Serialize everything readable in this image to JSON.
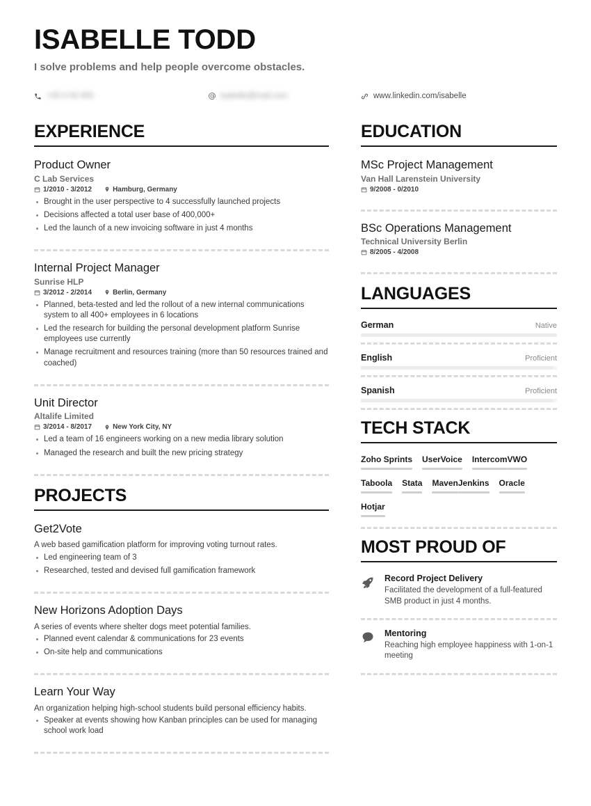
{
  "header": {
    "name": "ISABELLE TODD",
    "tagline": "I solve problems and help people overcome obstacles.",
    "contacts": {
      "phone": {
        "icon": "phone-icon",
        "value": "+00 0 00 000",
        "redacted": true
      },
      "email": {
        "icon": "at-icon",
        "value": "isabelle@mail.com",
        "redacted": true
      },
      "link": {
        "icon": "link-icon",
        "value": "www.linkedin.com/isabelle",
        "redacted": false
      }
    }
  },
  "sections": {
    "experience": {
      "title": "EXPERIENCE",
      "entries": [
        {
          "role": "Product Owner",
          "org": "C Lab Services",
          "dates": "1/2010 - 3/2012",
          "location": "Hamburg, Germany",
          "bullets": [
            "Brought in the user perspective to 4 successfully launched projects",
            "Decisions affected a total user base of 400,000+",
            "Led the launch of a new invoicing software in just 4 months"
          ]
        },
        {
          "role": "Internal Project Manager",
          "org": "Sunrise HLP",
          "dates": "3/2012 - 2/2014",
          "location": "Berlin, Germany",
          "bullets": [
            "Planned, beta-tested and led the rollout of a new internal communications system to all 400+ employees in 6 locations",
            "Led the research for building the personal development platform Sunrise employees use currently",
            "Manage recruitment and resources training (more than 50 resources trained and coached)"
          ]
        },
        {
          "role": "Unit Director",
          "org": "Altalife Limited",
          "dates": "3/2014 - 8/2017",
          "location": "New York City, NY",
          "bullets": [
            "Led a team of 16 engineers working on a new media library solution",
            "Managed the research and built the new pricing strategy"
          ]
        }
      ]
    },
    "projects": {
      "title": "PROJECTS",
      "entries": [
        {
          "name": "Get2Vote",
          "description": "A web based gamification platform for improving voting turnout rates.",
          "bullets": [
            "Led engineering team of 3",
            "Researched, tested and devised full gamification framework"
          ]
        },
        {
          "name": "New Horizons Adoption Days",
          "description": "A series of events where shelter dogs meet potential families.",
          "bullets": [
            "Planned event calendar & communications for 23 events",
            "On-site help and communications"
          ]
        },
        {
          "name": "Learn Your Way",
          "description": "An organization helping high-school students build personal efficiency habits.",
          "bullets": [
            "Speaker at events showing how Kanban principles can be used for managing school work load"
          ]
        }
      ]
    },
    "education": {
      "title": "EDUCATION",
      "entries": [
        {
          "degree": "MSc Project Management",
          "school": "Van Hall Larenstein University",
          "dates": "9/2008 - 0/2010"
        },
        {
          "degree": "BSc Operations Management",
          "school": "Technical University Berlin",
          "dates": "8/2005 - 4/2008"
        }
      ]
    },
    "languages": {
      "title": "LANGUAGES",
      "entries": [
        {
          "name": "German",
          "level": "Native",
          "fill": 100
        },
        {
          "name": "English",
          "level": "Proficient",
          "fill": 98
        },
        {
          "name": "Spanish",
          "level": "Proficient",
          "fill": 98
        }
      ]
    },
    "tech_stack": {
      "title": "TECH STACK",
      "items": [
        {
          "name": "Zoho Sprints",
          "fill": 100
        },
        {
          "name": "UserVoice",
          "fill": 100
        },
        {
          "name": "Intercom",
          "fill": 100
        },
        {
          "name": "VWO",
          "fill": 100
        },
        {
          "name": "Taboola",
          "fill": 100
        },
        {
          "name": "Stata",
          "fill": 100
        },
        {
          "name": "Maven",
          "fill": 100
        },
        {
          "name": "Jenkins",
          "fill": 100
        },
        {
          "name": "Oracle",
          "fill": 100
        },
        {
          "name": "Hotjar",
          "fill": 100
        }
      ]
    },
    "most_proud_of": {
      "title": "MOST PROUD OF",
      "entries": [
        {
          "icon": "rocket-icon",
          "title": "Record Project Delivery",
          "description": "Facilitated the development of a full-featured SMB product in just 4 months."
        },
        {
          "icon": "speech-bubble-icon",
          "title": "Mentoring",
          "description": "Reaching high employee happiness with  1-on-1 meeting"
        }
      ]
    }
  },
  "colors": {
    "text_primary": "#1b1b1b",
    "text_secondary": "#6f6f6f",
    "rule": "#1b1b1b",
    "dashed": "#d9d9d9",
    "bar": "#ebebeb"
  }
}
